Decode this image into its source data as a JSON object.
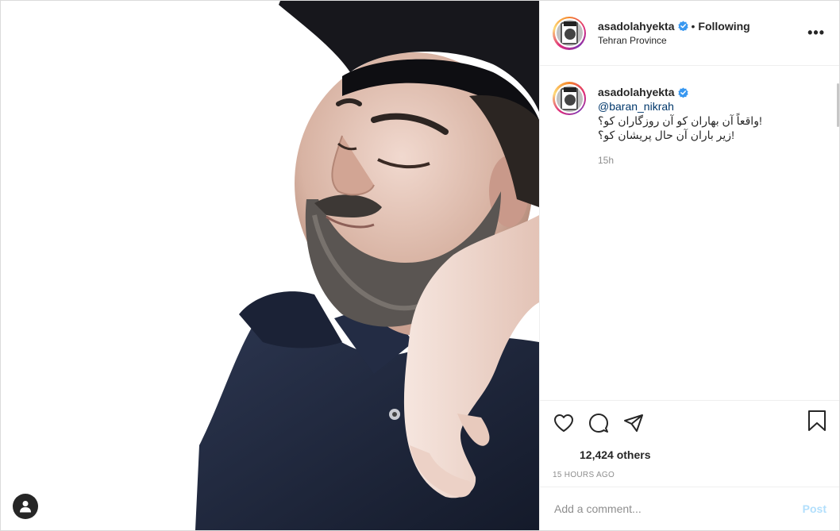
{
  "header": {
    "username": "asadolahyekta",
    "separator": "•",
    "follow_status": "Following",
    "location": "Tehran Province",
    "more_label": "•••"
  },
  "caption": {
    "username": "asadolahyekta",
    "mention": "@baran_nikrah",
    "lines": [
      "!واقعاً آن بهاران کو آن روزگاران کو؟",
      "!زیر باران آن حال پریشان کو؟"
    ],
    "age": "15h"
  },
  "engagement": {
    "likes": "12,424 others",
    "posted": "15 HOURS AGO"
  },
  "comment": {
    "placeholder": "Add a comment...",
    "post_label": "Post"
  },
  "icons": {
    "verified": "verified-badge-icon",
    "like": "heart-icon",
    "comment": "comment-bubble-icon",
    "share": "paper-plane-icon",
    "save": "bookmark-icon",
    "tags": "user-tag-icon",
    "more": "more-options-icon"
  },
  "colors": {
    "verified_blue": "#3897f0",
    "link": "#00376b",
    "post_disabled": "#b2dffc",
    "muted": "#8e8e8e",
    "text": "#262626"
  }
}
